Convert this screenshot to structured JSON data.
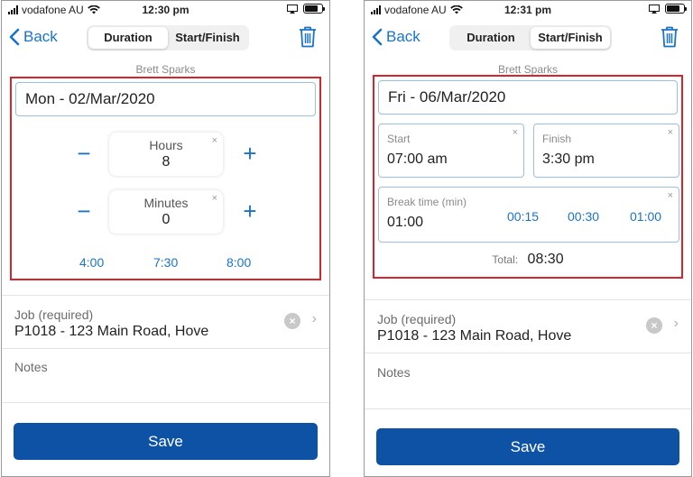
{
  "left": {
    "status": {
      "carrier": "vodafone AU",
      "time": "12:30 pm"
    },
    "nav": {
      "back_label": "Back",
      "tabs": [
        "Duration",
        "Start/Finish"
      ],
      "active_tab": "Duration"
    },
    "user_name": "Brett Sparks",
    "date": "Mon - 02/Mar/2020",
    "hours": {
      "label": "Hours",
      "value": "8",
      "minus": "−",
      "plus": "+",
      "clear": "×"
    },
    "minutes": {
      "label": "Minutes",
      "value": "0",
      "minus": "−",
      "plus": "+",
      "clear": "×"
    },
    "presets": [
      "4:00",
      "7:30",
      "8:00"
    ],
    "job": {
      "label": "Job (required)",
      "value": "P1018 - 123 Main Road, Hove"
    },
    "notes_label": "Notes",
    "save_label": "Save"
  },
  "right": {
    "status": {
      "carrier": "vodafone AU",
      "time": "12:31 pm"
    },
    "nav": {
      "back_label": "Back",
      "tabs": [
        "Duration",
        "Start/Finish"
      ],
      "active_tab": "Start/Finish"
    },
    "user_name": "Brett Sparks",
    "date": "Fri - 06/Mar/2020",
    "start": {
      "label": "Start",
      "value": "07:00 am",
      "clear": "×"
    },
    "finish": {
      "label": "Finish",
      "value": "3:30 pm",
      "clear": "×"
    },
    "break": {
      "label": "Break time (min)",
      "value": "01:00",
      "options": [
        "00:15",
        "00:30",
        "01:00"
      ],
      "clear": "×"
    },
    "total": {
      "label": "Total:",
      "value": "08:30"
    },
    "job": {
      "label": "Job (required)",
      "value": "P1018 - 123 Main Road, Hove"
    },
    "notes_label": "Notes",
    "save_label": "Save"
  },
  "colors": {
    "accent": "#1a73c9",
    "highlight_border": "#d9242b",
    "save_button": "#0e52a5",
    "field_border": "#9bbfe2"
  },
  "icons": [
    "wifi-icon",
    "signal-icon",
    "battery-icon",
    "screen-mirror-icon",
    "back-chevron-icon",
    "trash-icon",
    "clear-icon",
    "chevron-right-icon"
  ]
}
